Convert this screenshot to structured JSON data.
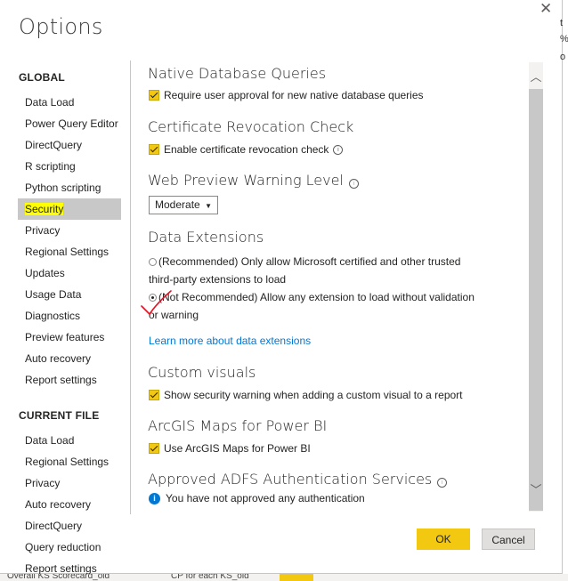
{
  "dialog": {
    "title": "Options",
    "close_glyph": "✕"
  },
  "edge_fragments": [
    "t",
    "%",
    "o"
  ],
  "nav": {
    "global_heading": "GLOBAL",
    "global_items": [
      "Data Load",
      "Power Query Editor",
      "DirectQuery",
      "R scripting",
      "Python scripting",
      "Security",
      "Privacy",
      "Regional Settings",
      "Updates",
      "Usage Data",
      "Diagnostics",
      "Preview features",
      "Auto recovery",
      "Report settings"
    ],
    "active_item": "Security",
    "current_heading": "CURRENT FILE",
    "current_items": [
      "Data Load",
      "Regional Settings",
      "Privacy",
      "Auto recovery",
      "DirectQuery",
      "Query reduction",
      "Report settings"
    ]
  },
  "sections": {
    "native_db": {
      "title": "Native Database Queries",
      "checkbox_label": "Require user approval for new native database queries",
      "checked": true
    },
    "cert": {
      "title": "Certificate Revocation Check",
      "checkbox_label": "Enable certificate revocation check",
      "checked": true
    },
    "web_preview": {
      "title": "Web Preview Warning Level",
      "dropdown_value": "Moderate",
      "dropdown_arrow": "▼"
    },
    "data_ext": {
      "title": "Data Extensions",
      "option1_line1": "(Recommended) Only allow Microsoft certified and other trusted",
      "option1_line2": "third-party extensions to load",
      "option2_line1": "(Not Recommended) Allow any extension to load without validation",
      "option2_line2": "or warning",
      "selected_option": 2,
      "link": "Learn more about data extensions"
    },
    "custom_visuals": {
      "title": "Custom visuals",
      "checkbox_label": "Show security warning when adding a custom visual to a report",
      "checked": true
    },
    "arcgis": {
      "title": "ArcGIS Maps for Power BI",
      "checkbox_label": "Use ArcGIS Maps for Power BI",
      "checked": true
    },
    "adfs": {
      "title": "Approved ADFS Authentication Services",
      "info_text": "You have not approved any authentication"
    }
  },
  "buttons": {
    "ok": "OK",
    "cancel": "Cancel"
  },
  "background_tabs": [
    "Overall KS Scorecard_old",
    "CP for each KS_old"
  ],
  "colors": {
    "accent_yellow": "#f2c811",
    "link_blue": "#0078d4",
    "highlight": "#ffff00",
    "annotation_red": "#e81123"
  }
}
